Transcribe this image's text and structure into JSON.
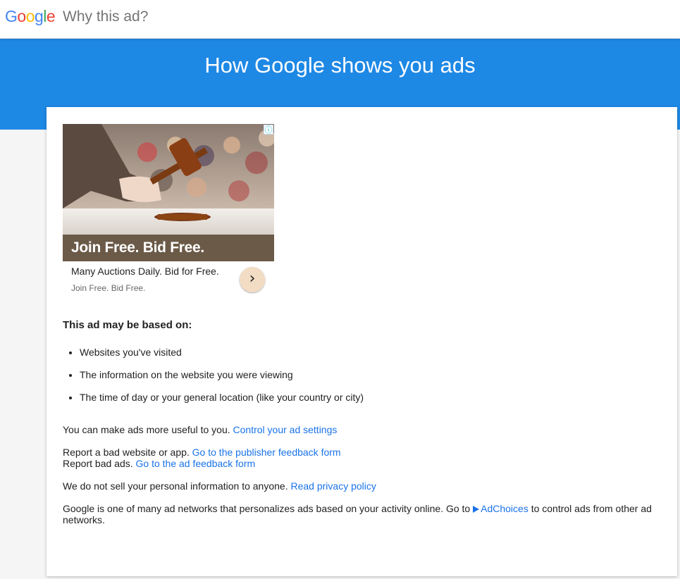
{
  "header": {
    "logo_letters": [
      "G",
      "o",
      "o",
      "g",
      "l",
      "e"
    ],
    "logo_colors": [
      "#4285F4",
      "#EA4335",
      "#FBBC05",
      "#4285F4",
      "#34A853",
      "#EA4335"
    ],
    "title": "Why this ad?"
  },
  "banner": {
    "title": "How Google shows you ads",
    "color": "#1e88e5"
  },
  "ad": {
    "image_description_icon": "auction-gavel-image",
    "headline": "Join Free. Bid Free.",
    "title": "Many Auctions Daily. Bid for Free.",
    "description": "Join Free. Bid Free.",
    "info_icon": "ⓘ",
    "arrow_icon": "›"
  },
  "based_on": {
    "heading": "This ad may be based on:",
    "items": [
      "Websites you've visited",
      "The information on the website you were viewing",
      "The time of day or your general location (like your country or city)"
    ]
  },
  "settings": {
    "text": "You can make ads more useful to you.",
    "link": "Control your ad settings"
  },
  "report_website": {
    "text": "Report a bad website or app.",
    "link": "Go to the publisher feedback form"
  },
  "report_ads": {
    "text": "Report bad ads.",
    "link": "Go to the ad feedback form"
  },
  "privacy": {
    "text": "We do not sell your personal information to anyone.",
    "link": "Read privacy policy"
  },
  "networks": {
    "text_before": "Google is one of many ad networks that personalizes ads based on your activity online. Go to",
    "link": "AdChoices",
    "text_after": "to control ads from other ad networks."
  },
  "colors": {
    "link": "#1a73e8",
    "accent": "#1e88e5"
  }
}
